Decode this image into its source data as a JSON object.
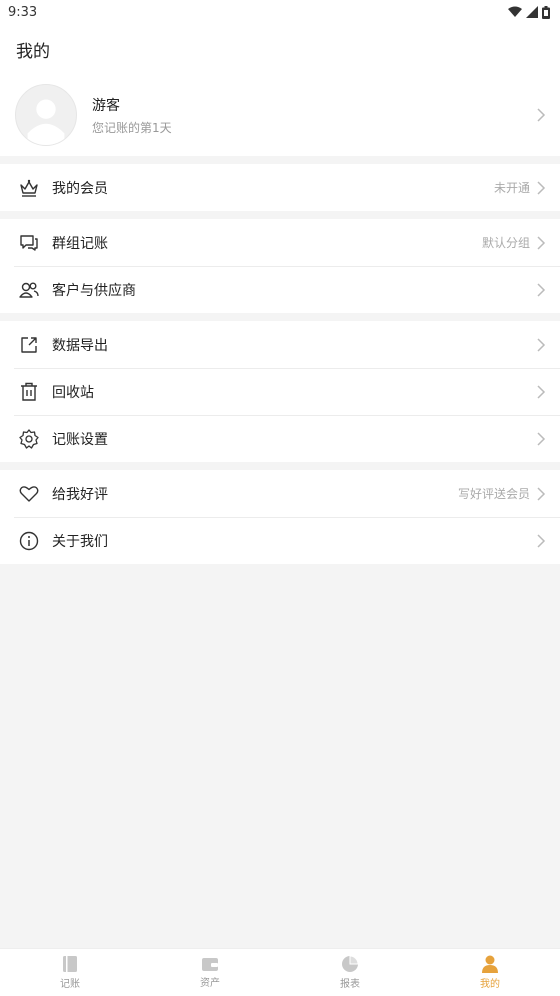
{
  "status": {
    "time": "9:33"
  },
  "header": {
    "title": "我的"
  },
  "profile": {
    "name": "游客",
    "subtitle": "您记账的第1天"
  },
  "groups": [
    [
      {
        "label": "我的会员",
        "hint": "未开通",
        "icon": "crown-icon"
      }
    ],
    [
      {
        "label": "群组记账",
        "hint": "默认分组",
        "icon": "chat-bubbles-icon"
      },
      {
        "label": "客户与供应商",
        "hint": "",
        "icon": "contacts-icon"
      }
    ],
    [
      {
        "label": "数据导出",
        "hint": "",
        "icon": "export-icon"
      },
      {
        "label": "回收站",
        "hint": "",
        "icon": "trash-icon"
      },
      {
        "label": "记账设置",
        "hint": "",
        "icon": "gear-icon"
      }
    ],
    [
      {
        "label": "给我好评",
        "hint": "写好评送会员",
        "icon": "heart-icon"
      },
      {
        "label": "关于我们",
        "hint": "",
        "icon": "info-icon"
      }
    ]
  ],
  "tabs": [
    {
      "label": "记账",
      "icon": "book-icon",
      "active": false
    },
    {
      "label": "资产",
      "icon": "wallet-icon",
      "active": false
    },
    {
      "label": "报表",
      "icon": "pie-chart-icon",
      "active": false
    },
    {
      "label": "我的",
      "icon": "person-icon",
      "active": true
    }
  ],
  "colors": {
    "accent": "#e6a23c",
    "background": "#f4f4f4"
  }
}
